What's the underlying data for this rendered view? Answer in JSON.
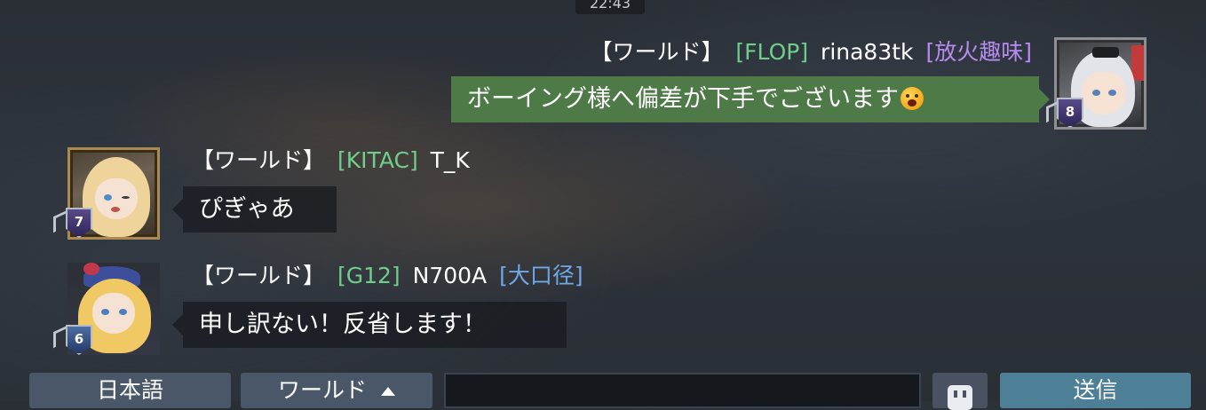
{
  "status": {
    "time": "22:43"
  },
  "messages": [
    {
      "channel": "【ワールド】",
      "clan": "[FLOP]",
      "username": "rina83tk",
      "title": "[放火趣味]",
      "text": "ボーイング様へ偏差が下手でございます",
      "rank": "8",
      "own": true
    },
    {
      "channel": "【ワールド】",
      "clan": "[KITAC]",
      "username": "T_K",
      "title": "",
      "text": "ぴぎゃあ",
      "rank": "7",
      "own": false
    },
    {
      "channel": "【ワールド】",
      "clan": "[G12]",
      "username": "N700A",
      "title": "[大口径]",
      "text": "申し訳ない！反省します！",
      "rank": "6",
      "own": false
    }
  ],
  "bottom_bar": {
    "language_label": "日本語",
    "channel_label": "ワールド",
    "input_value": "",
    "input_placeholder": "",
    "send_label": "送信"
  },
  "colors": {
    "clan_tag": "#6fce8b",
    "title_purple": "#b68cf0",
    "title_blue": "#6fa7e8",
    "own_bubble": "#4d7a47",
    "send_button": "#4d7f97"
  }
}
